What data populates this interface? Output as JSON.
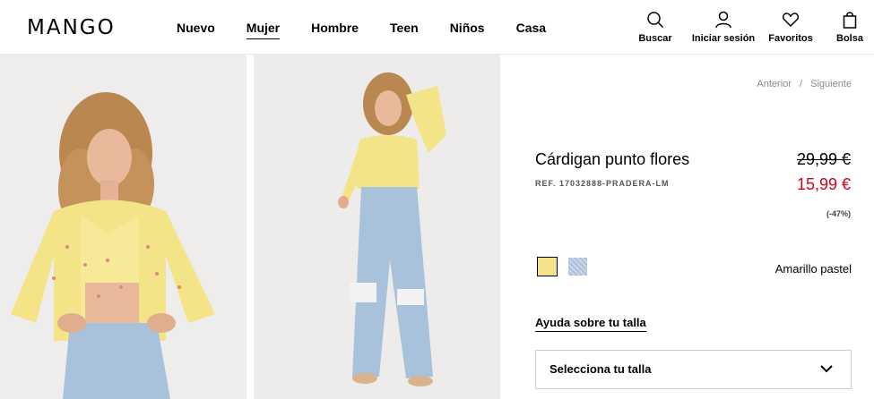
{
  "brand": {
    "logo": "MANGO"
  },
  "nav": {
    "items": [
      "Nuevo",
      "Mujer",
      "Hombre",
      "Teen",
      "Niños",
      "Casa"
    ],
    "active": "Mujer"
  },
  "tools": {
    "search": "Buscar",
    "login": "Iniciar sesión",
    "favorites": "Favoritos",
    "bag": "Bolsa"
  },
  "breadcrumb": {
    "previous": "Anterior",
    "separator": "/",
    "next": "Siguiente"
  },
  "product": {
    "title": "Cárdigan punto flores",
    "ref": "REF. 17032888-PRADERA-LM",
    "old_price": "29,99 €",
    "new_price": "15,99 €",
    "discount": "(-47%)",
    "color_name": "Amarillo pastel",
    "colors": [
      {
        "name": "Amarillo pastel",
        "hex": "#f2e38a",
        "selected": true
      },
      {
        "name": "Azul",
        "hex": "#b9c9e0",
        "selected": false
      }
    ],
    "size_help": "Ayuda sobre tu talla",
    "size_select": "Selecciona tu talla"
  },
  "theme": {
    "sale_color": "#d0021b",
    "border_color": "#cccccc"
  }
}
